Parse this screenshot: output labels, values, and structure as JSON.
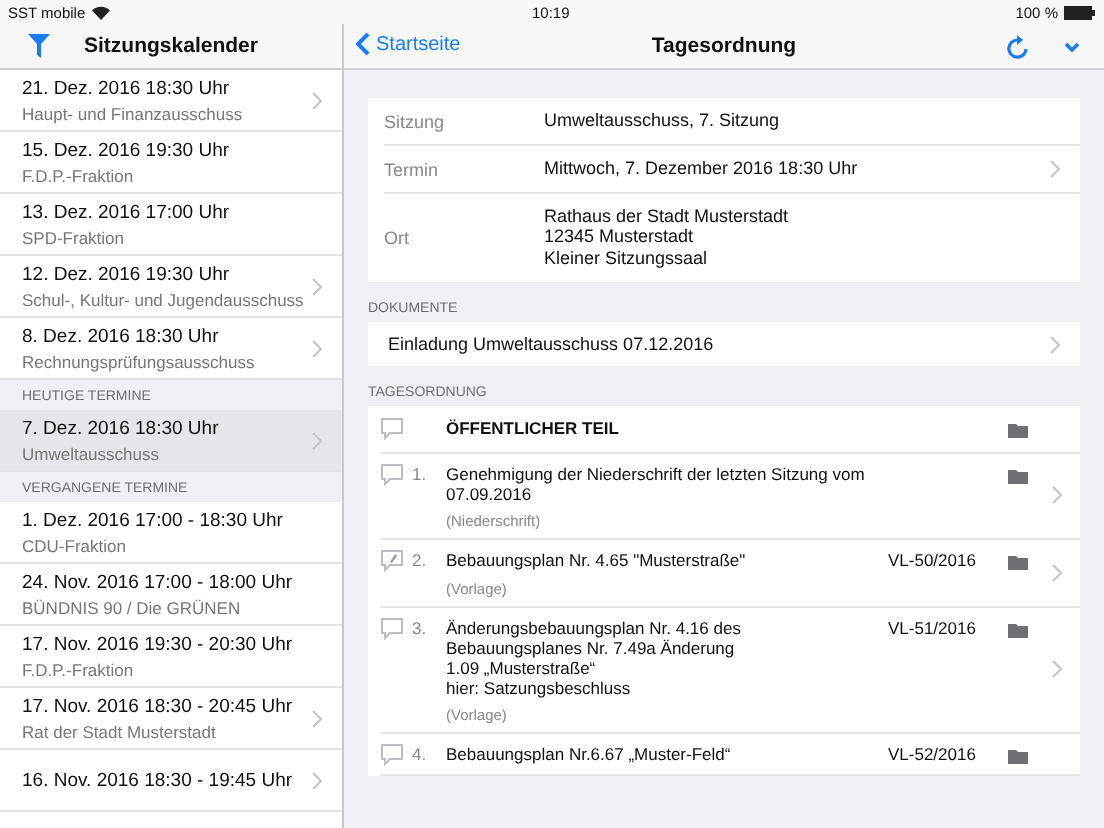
{
  "status_bar": {
    "carrier": "SST mobile",
    "time": "10:19",
    "battery": "100 %"
  },
  "sidebar": {
    "title": "Sitzungskalender",
    "sections": [
      {
        "items": [
          {
            "date": "21. Dez. 2016 18:30 Uhr",
            "subtitle": "Haupt- und Finanzausschuss",
            "chevron": true,
            "selected": false
          },
          {
            "date": "15. Dez. 2016 19:30 Uhr",
            "subtitle": "F.D.P.-Fraktion",
            "chevron": false,
            "selected": false
          },
          {
            "date": "13. Dez. 2016 17:00 Uhr",
            "subtitle": "SPD-Fraktion",
            "chevron": false,
            "selected": false
          },
          {
            "date": "12. Dez. 2016 19:30 Uhr",
            "subtitle": "Schul-, Kultur- und Jugendausschuss",
            "chevron": true,
            "selected": false
          },
          {
            "date": "8. Dez. 2016 18:30 Uhr",
            "subtitle": "Rechnungsprüfungsausschuss",
            "chevron": true,
            "selected": false
          }
        ]
      },
      {
        "header": "HEUTIGE TERMINE",
        "items": [
          {
            "date": "7. Dez. 2016 18:30 Uhr",
            "subtitle": "Umweltausschuss",
            "chevron": true,
            "selected": true
          }
        ]
      },
      {
        "header": "VERGANGENE TERMINE",
        "items": [
          {
            "date": "1. Dez. 2016 17:00 - 18:30 Uhr",
            "subtitle": "CDU-Fraktion",
            "chevron": false,
            "selected": false
          },
          {
            "date": "24. Nov. 2016 17:00 - 18:00 Uhr",
            "subtitle": "BÜNDNIS 90 / Die GRÜNEN",
            "chevron": false,
            "selected": false
          },
          {
            "date": "17. Nov. 2016 19:30 - 20:30 Uhr",
            "subtitle": "F.D.P.-Fraktion",
            "chevron": false,
            "selected": false
          },
          {
            "date": "17. Nov. 2016 18:30 - 20:45 Uhr",
            "subtitle": "Rat der Stadt Musterstadt",
            "chevron": true,
            "selected": false
          },
          {
            "date": "16. Nov. 2016 18:30 - 19:45 Uhr",
            "chevron": true,
            "selected": false
          }
        ]
      }
    ]
  },
  "detail": {
    "back": "Startseite",
    "title": "Tagesordnung",
    "info": [
      {
        "label": "Sitzung",
        "lines": [
          "Umweltausschuss, 7. Sitzung"
        ],
        "chevron": false
      },
      {
        "label": "Termin",
        "lines": [
          "Mittwoch, 7. Dezember 2016 18:30 Uhr"
        ],
        "chevron": true
      },
      {
        "label": "Ort",
        "lines": [
          "Rathaus der Stadt Musterstadt",
          "12345 Musterstadt",
          "Kleiner Sitzungssaal"
        ],
        "chevron": false
      }
    ],
    "documents_header": "DOKUMENTE",
    "documents": [
      {
        "title": "Einladung Umweltausschuss 07.12.2016",
        "chevron": true
      }
    ],
    "agenda_header": "TAGESORDNUNG",
    "agenda": [
      {
        "kind": "section",
        "title_lines": [
          "ÖFFENTLICHER TEIL"
        ],
        "chevron": false,
        "annotated": false
      },
      {
        "kind": "item",
        "number": "1.",
        "title_lines": [
          "Genehmigung der Niederschrift der letzten Sitzung vom",
          "07.09.2016"
        ],
        "type": "(Niederschrift)",
        "chevron": true,
        "annotated": false
      },
      {
        "kind": "item",
        "number": "2.",
        "title_lines": [
          "Bebauungsplan Nr. 4.65 \"Musterstraße\""
        ],
        "type": "(Vorlage)",
        "reference": "VL-50/2016",
        "chevron": true,
        "annotated": true
      },
      {
        "kind": "item",
        "number": "3.",
        "title_lines": [
          "Änderungsbebauungsplan Nr. 4.16 des",
          "Bebauungsplanes Nr. 7.49a Änderung",
          "1.09 „Musterstraße“",
          "hier: Satzungsbeschluss"
        ],
        "type": "(Vorlage)",
        "reference": "VL-51/2016",
        "chevron": true,
        "annotated": false
      },
      {
        "kind": "item",
        "number": "4.",
        "title_lines": [
          "Bebauungsplan Nr.6.67 „Muster-Feld“"
        ],
        "reference": "VL-52/2016",
        "chevron": false,
        "annotated": false
      }
    ]
  }
}
